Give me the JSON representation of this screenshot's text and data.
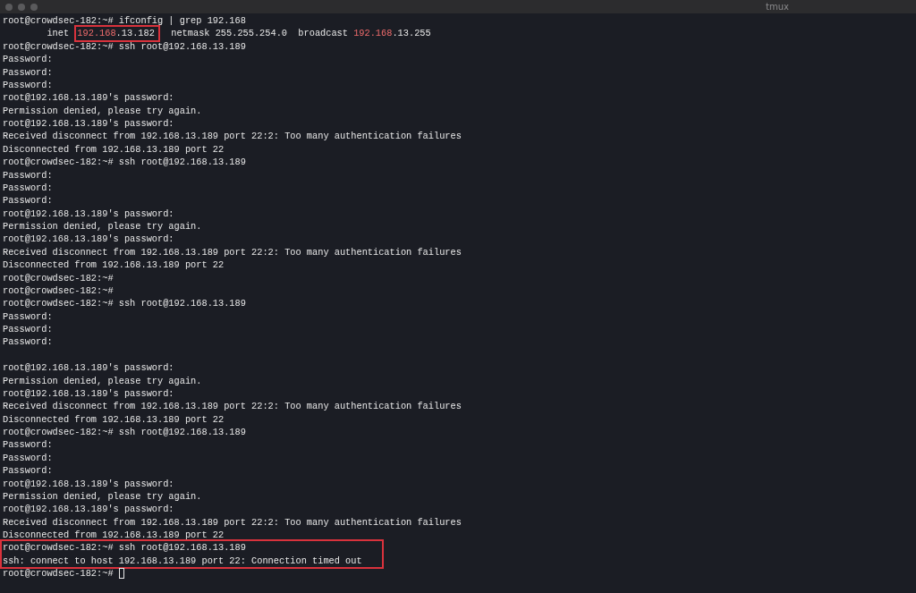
{
  "window": {
    "title": "tmux"
  },
  "terminal": {
    "cursor": true,
    "lines": [
      {
        "kind": "text",
        "boxed": false,
        "text": "root@crowdsec-182:~# ifconfig | grep 192.168"
      },
      {
        "kind": "segments",
        "boxed": false,
        "segments": [
          {
            "text": "        inet ",
            "boxed": false,
            "highlight": false
          },
          {
            "text": "192.168",
            "boxed": true,
            "highlight": true
          },
          {
            "text": ".13.182",
            "boxed": true,
            "highlight": false
          },
          {
            "text": "  netmask 255.255.254.0  broadcast ",
            "boxed": false,
            "highlight": false
          },
          {
            "text": "192.168",
            "boxed": false,
            "highlight": true
          },
          {
            "text": ".13.255",
            "boxed": false,
            "highlight": false
          }
        ]
      },
      {
        "kind": "text",
        "boxed": false,
        "text": "root@crowdsec-182:~# ssh root@192.168.13.189"
      },
      {
        "kind": "text",
        "boxed": false,
        "text": "Password:"
      },
      {
        "kind": "text",
        "boxed": false,
        "text": "Password:"
      },
      {
        "kind": "text",
        "boxed": false,
        "text": "Password:"
      },
      {
        "kind": "text",
        "boxed": false,
        "text": "root@192.168.13.189's password:"
      },
      {
        "kind": "text",
        "boxed": false,
        "text": "Permission denied, please try again."
      },
      {
        "kind": "text",
        "boxed": false,
        "text": "root@192.168.13.189's password:"
      },
      {
        "kind": "text",
        "boxed": false,
        "text": "Received disconnect from 192.168.13.189 port 22:2: Too many authentication failures"
      },
      {
        "kind": "text",
        "boxed": false,
        "text": "Disconnected from 192.168.13.189 port 22"
      },
      {
        "kind": "text",
        "boxed": false,
        "text": "root@crowdsec-182:~# ssh root@192.168.13.189"
      },
      {
        "kind": "text",
        "boxed": false,
        "text": "Password:"
      },
      {
        "kind": "text",
        "boxed": false,
        "text": "Password:"
      },
      {
        "kind": "text",
        "boxed": false,
        "text": "Password:"
      },
      {
        "kind": "text",
        "boxed": false,
        "text": "root@192.168.13.189's password:"
      },
      {
        "kind": "text",
        "boxed": false,
        "text": "Permission denied, please try again."
      },
      {
        "kind": "text",
        "boxed": false,
        "text": "root@192.168.13.189's password:"
      },
      {
        "kind": "text",
        "boxed": false,
        "text": "Received disconnect from 192.168.13.189 port 22:2: Too many authentication failures"
      },
      {
        "kind": "text",
        "boxed": false,
        "text": "Disconnected from 192.168.13.189 port 22"
      },
      {
        "kind": "text",
        "boxed": false,
        "text": "root@crowdsec-182:~#"
      },
      {
        "kind": "text",
        "boxed": false,
        "text": "root@crowdsec-182:~#"
      },
      {
        "kind": "text",
        "boxed": false,
        "text": "root@crowdsec-182:~# ssh root@192.168.13.189"
      },
      {
        "kind": "text",
        "boxed": false,
        "text": "Password:"
      },
      {
        "kind": "text",
        "boxed": false,
        "text": "Password:"
      },
      {
        "kind": "text",
        "boxed": false,
        "text": "Password:"
      },
      {
        "kind": "blank",
        "boxed": false
      },
      {
        "kind": "text",
        "boxed": false,
        "text": "root@192.168.13.189's password:"
      },
      {
        "kind": "text",
        "boxed": false,
        "text": "Permission denied, please try again."
      },
      {
        "kind": "text",
        "boxed": false,
        "text": "root@192.168.13.189's password:"
      },
      {
        "kind": "text",
        "boxed": false,
        "text": "Received disconnect from 192.168.13.189 port 22:2: Too many authentication failures"
      },
      {
        "kind": "text",
        "boxed": false,
        "text": "Disconnected from 192.168.13.189 port 22"
      },
      {
        "kind": "text",
        "boxed": false,
        "text": "root@crowdsec-182:~# ssh root@192.168.13.189"
      },
      {
        "kind": "text",
        "boxed": false,
        "text": "Password:"
      },
      {
        "kind": "text",
        "boxed": false,
        "text": "Password:"
      },
      {
        "kind": "text",
        "boxed": false,
        "text": "Password:"
      },
      {
        "kind": "text",
        "boxed": false,
        "text": "root@192.168.13.189's password:"
      },
      {
        "kind": "text",
        "boxed": false,
        "text": "Permission denied, please try again."
      },
      {
        "kind": "text",
        "boxed": false,
        "text": "root@192.168.13.189's password:"
      },
      {
        "kind": "text",
        "boxed": false,
        "text": "Received disconnect from 192.168.13.189 port 22:2: Too many authentication failures"
      },
      {
        "kind": "text",
        "boxed": false,
        "text": "Disconnected from 192.168.13.189 port 22"
      },
      {
        "kind": "text",
        "boxed": true,
        "text": "root@crowdsec-182:~# ssh root@192.168.13.189"
      },
      {
        "kind": "text",
        "boxed": true,
        "text": "ssh: connect to host 192.168.13.189 port 22: Connection timed out"
      },
      {
        "kind": "text",
        "boxed": false,
        "text": "root@crowdsec-182:~# "
      }
    ]
  }
}
